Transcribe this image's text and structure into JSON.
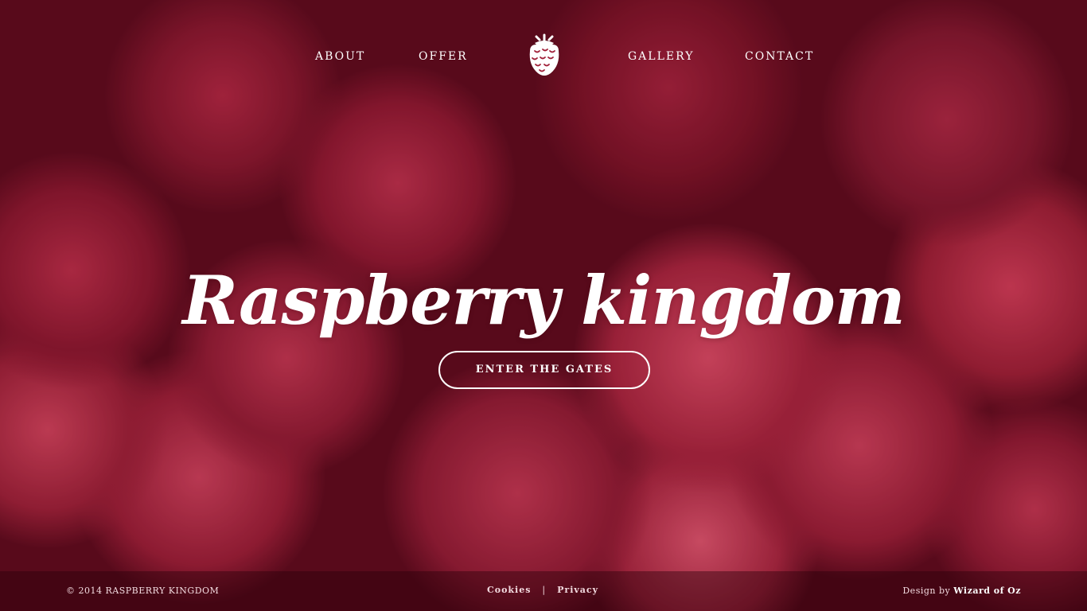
{
  "nav": {
    "items": [
      {
        "label": "ABOUT"
      },
      {
        "label": "OFFER"
      },
      {
        "label": "GALLERY"
      },
      {
        "label": "CONTACT"
      }
    ],
    "logo_icon": "raspberry-icon"
  },
  "hero": {
    "title": "Raspberry kingdom",
    "cta_label": "ENTER THE GATES"
  },
  "footer": {
    "copyright": "© 2014 RASPBERRY KINGDOM",
    "links": [
      {
        "label": "Cookies"
      },
      {
        "label": "Privacy"
      }
    ],
    "separator": "|",
    "credit_prefix": "Design by",
    "credit_name": "Wizard of Oz"
  },
  "colors": {
    "text": "#ffffff",
    "background_tint": "#8a1a30",
    "footer_bg": "rgba(40,0,10,0.42)"
  }
}
